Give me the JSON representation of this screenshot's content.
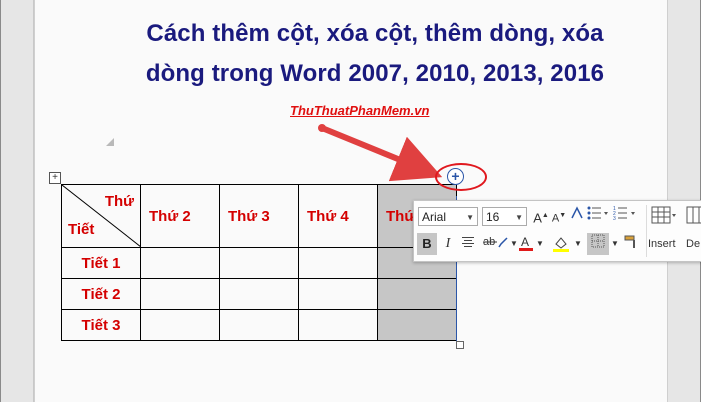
{
  "doc": {
    "title_line1": "Cách thêm cột, xóa cột, thêm dòng, xóa",
    "title_line2": "dòng trong Word 2007, 2010, 2013, 2016",
    "site": "ThuThuatPhanMem.vn"
  },
  "table": {
    "corner_top": "Thứ",
    "corner_bottom": "Tiết",
    "col_headers": [
      "Thứ 2",
      "Thứ 3",
      "Thứ 4",
      "Thứ"
    ],
    "row_headers": [
      "Tiết 1",
      "Tiết 2",
      "Tiết 3"
    ]
  },
  "toolbar": {
    "font_name": "Arial",
    "font_size": "16",
    "insert_label": "Insert",
    "delete_label": "De"
  },
  "colors": {
    "title": "#1a1a7e",
    "red_text": "#d40000",
    "highlight_circle": "#e0181e",
    "selected_column": "#c6c6c6",
    "font_color_bar": "#e01a1a",
    "highlight_bar": "#ffff00",
    "arrow": "#e04040"
  },
  "icons": [
    "table-move-icon",
    "insert-column-plus-icon",
    "grow-font-icon",
    "shrink-font-icon",
    "styles-icon",
    "bullets-icon",
    "numbering-icon",
    "table-insert-icon",
    "bold-icon",
    "italic-icon",
    "center-align-icon",
    "strikethrough-icon",
    "font-color-icon",
    "shading-icon",
    "borders-icon",
    "format-painter-icon"
  ]
}
